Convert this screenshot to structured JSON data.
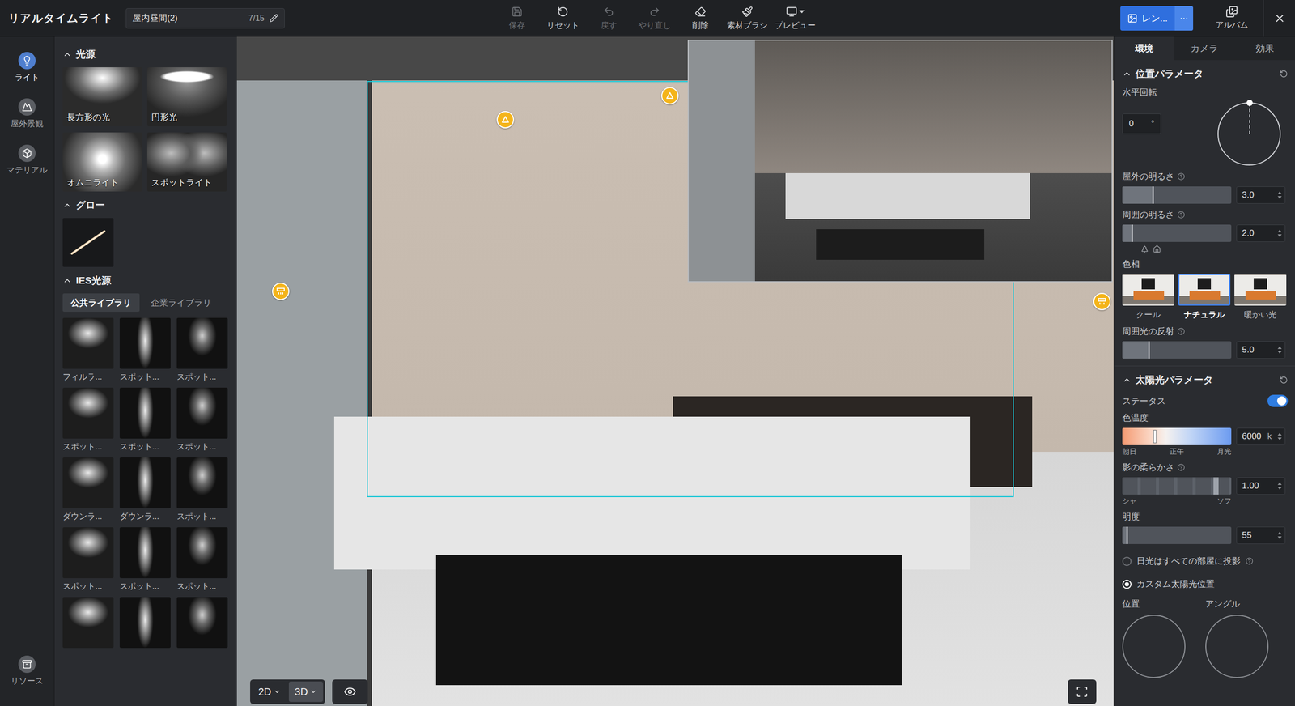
{
  "app": {
    "title": "リアルタイムライト",
    "scene": {
      "name": "屋内昼間(2)",
      "count": "7/15"
    }
  },
  "toolbar": [
    {
      "label": "保存",
      "disabled": true
    },
    {
      "label": "リセット",
      "disabled": false
    },
    {
      "label": "戻す",
      "disabled": true
    },
    {
      "label": "やり直し",
      "disabled": true
    },
    {
      "label": "削除",
      "disabled": false
    },
    {
      "label": "素材ブラシ",
      "disabled": false
    },
    {
      "label": "プレビュー",
      "disabled": false
    }
  ],
  "render": {
    "label": "レン...",
    "more": "···"
  },
  "album": {
    "label": "アルバム"
  },
  "rail": [
    {
      "label": "ライト",
      "selected": true
    },
    {
      "label": "屋外景観",
      "selected": false
    },
    {
      "label": "マテリアル",
      "selected": false
    },
    {
      "label": "リソース",
      "selected": false
    }
  ],
  "lightSources": {
    "title": "光源",
    "expanded": true,
    "items": [
      {
        "label": "長方形の光"
      },
      {
        "label": "円形光"
      },
      {
        "label": "オムニライト"
      },
      {
        "label": "スポットライト"
      }
    ]
  },
  "glow": {
    "title": "グロー",
    "expanded": true
  },
  "ies": {
    "title": "IES光源",
    "expanded": true,
    "tabs": [
      {
        "label": "公共ライブラリ",
        "selected": true
      },
      {
        "label": "企業ライブラリ",
        "selected": false
      }
    ],
    "items": [
      {
        "label": "フィルラ..."
      },
      {
        "label": "スポット..."
      },
      {
        "label": "スポット..."
      },
      {
        "label": "スポット..."
      },
      {
        "label": "スポット..."
      },
      {
        "label": "スポット..."
      },
      {
        "label": "ダウンラ..."
      },
      {
        "label": "ダウンラ..."
      },
      {
        "label": "スポット..."
      },
      {
        "label": "スポット..."
      },
      {
        "label": "スポット..."
      },
      {
        "label": "スポット..."
      },
      {
        "label": ""
      },
      {
        "label": ""
      },
      {
        "label": ""
      }
    ]
  },
  "canvas": {
    "modes": [
      {
        "label": "2D",
        "selected": false
      },
      {
        "label": "3D",
        "selected": true
      }
    ],
    "lights": [
      {
        "kind": "cone"
      },
      {
        "kind": "cone"
      },
      {
        "kind": "panel"
      },
      {
        "kind": "panel"
      }
    ]
  },
  "panelTabs": [
    {
      "label": "環境",
      "selected": true
    },
    {
      "label": "カメラ",
      "selected": false
    },
    {
      "label": "効果",
      "selected": false
    }
  ],
  "position": {
    "title": "位置パラメータ",
    "expanded": true,
    "rotation": {
      "label": "水平回転",
      "value": "0",
      "unit": "°"
    },
    "sliders": [
      {
        "label": "屋外の明るさ",
        "help": true,
        "level": 0.29,
        "value": "3.0",
        "sceneIcons": false
      },
      {
        "label": "周囲の明るさ",
        "help": true,
        "level": 0.1,
        "value": "2.0",
        "sceneIcons": true
      }
    ],
    "hue": {
      "label": "色相",
      "options": [
        {
          "label": "クール",
          "selected": false
        },
        {
          "label": "ナチュラル",
          "selected": true
        },
        {
          "label": "暖かい光",
          "selected": false
        }
      ]
    },
    "reflection": {
      "label": "周囲光の反射",
      "help": true,
      "level": 0.25,
      "value": "5.0"
    }
  },
  "sun": {
    "title": "太陽光パラメータ",
    "expanded": true,
    "status": {
      "label": "ステータス",
      "on": true
    },
    "temperature": {
      "label": "色温度",
      "level": 0.3,
      "value": "6000",
      "unit": "k",
      "ticks": [
        "朝日",
        "正午",
        "月光"
      ]
    },
    "softness": {
      "label": "影の柔らかさ",
      "help": true,
      "level": 0.86,
      "value": "1.00",
      "ticks": [
        "シャ",
        "ソフ"
      ]
    },
    "brightness": {
      "label": "明度",
      "help": false,
      "level": 0.05,
      "value": "55"
    },
    "radios": [
      {
        "label": "日光はすべての部屋に投影",
        "selected": false,
        "help": true
      },
      {
        "label": "カスタム太陽光位置",
        "selected": true,
        "help": false
      }
    ],
    "bottom": [
      "位置",
      "アングル"
    ]
  }
}
